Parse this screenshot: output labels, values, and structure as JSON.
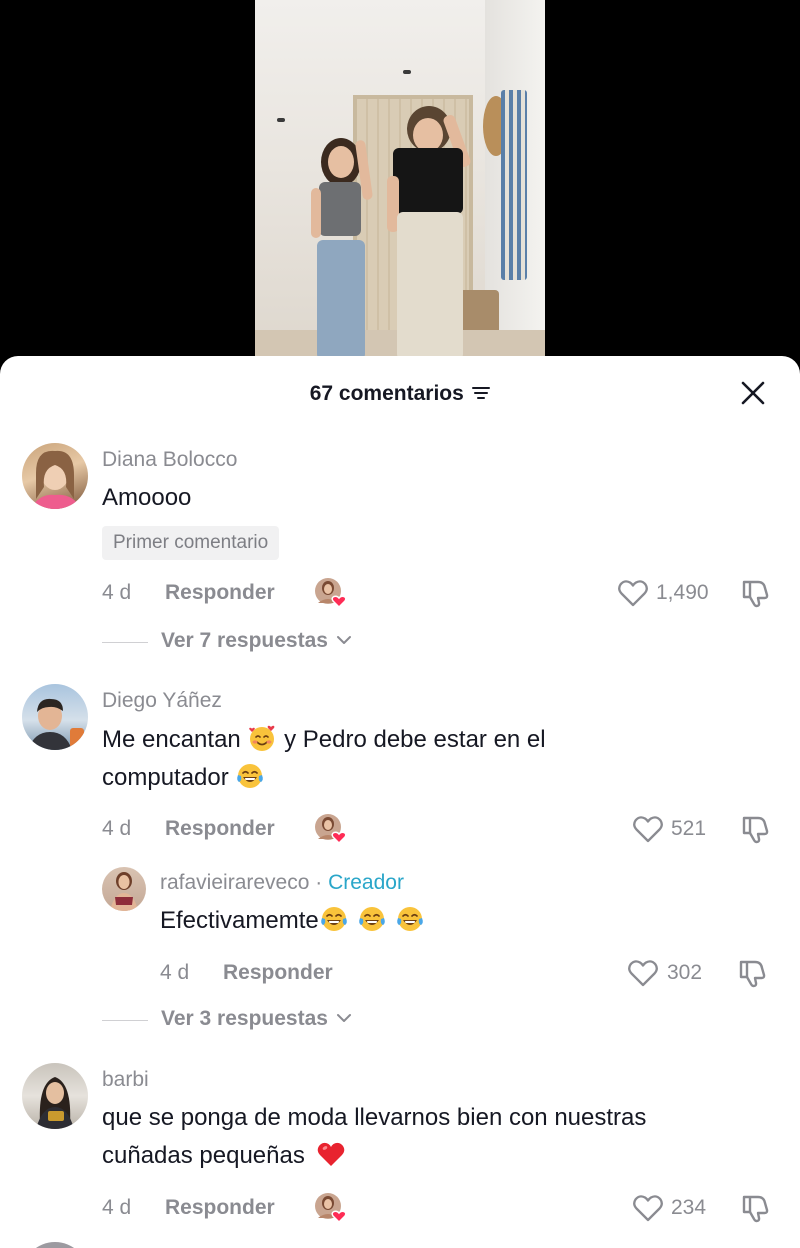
{
  "sheet": {
    "title": "67 comentarios",
    "sort_icon": "sort-lines-icon",
    "close_icon": "close-x-icon"
  },
  "comments": [
    {
      "username": "Diana Bolocco",
      "text": "Amoooo",
      "badge": "Primer comentario",
      "time": "4 d",
      "reply_label": "Responder",
      "likes": "1,490",
      "view_replies": "Ver 7 respuestas"
    },
    {
      "username": "Diego Yáñez",
      "text_line1_a": "Me encantan",
      "text_line1_b": "y Pedro debe estar en el",
      "text_line2": "computador",
      "time": "4 d",
      "reply_label": "Responder",
      "likes": "521",
      "reply": {
        "username": "rafavieirareveco",
        "separator": "·",
        "creator_label": "Creador",
        "text": "Efectivamemte",
        "time": "4 d",
        "reply_label": "Responder",
        "likes": "302"
      },
      "view_replies": "Ver 3 respuestas"
    },
    {
      "username": "barbi",
      "text_line1": "que se ponga de moda llevarnos bien con nuestras",
      "text_line2": "cuñadas pequeñas",
      "time": "4 d",
      "reply_label": "Responder",
      "likes": "234"
    }
  ],
  "colors": {
    "text_primary": "#161823",
    "text_secondary": "#8a8b91",
    "creator": "#2aa6c9",
    "heart_badge": "#fe2c55"
  }
}
